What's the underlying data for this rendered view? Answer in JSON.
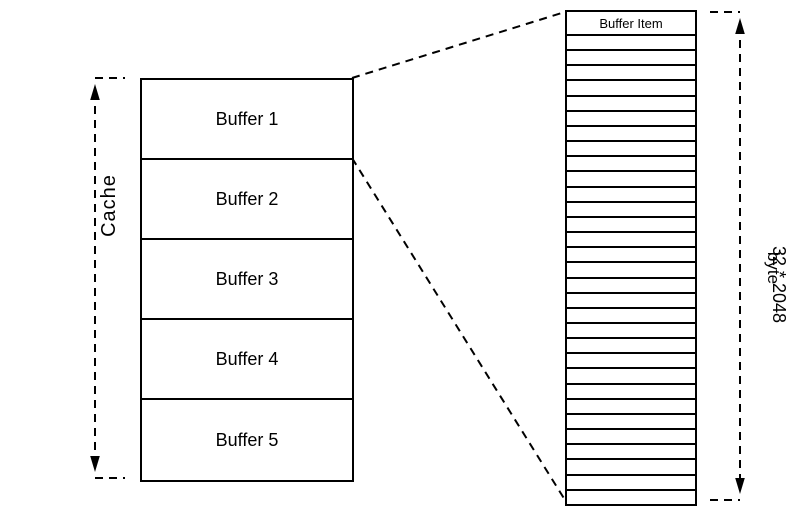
{
  "left_label": "Cache",
  "cache_cells": [
    "Buffer 1",
    "Buffer 2",
    "Buffer 3",
    "Buffer 4",
    "Buffer 5"
  ],
  "detail_header": "Buffer Item",
  "detail_row_count": 31,
  "right_line1": "32 * 2048",
  "right_line2": "byte",
  "chart_data": {
    "type": "diagram",
    "cache": {
      "name": "Cache",
      "buffers": [
        "Buffer 1",
        "Buffer 2",
        "Buffer 3",
        "Buffer 4",
        "Buffer 5"
      ]
    },
    "buffer_expansion": {
      "items_per_buffer": 32,
      "bytes_per_item": 2048,
      "item_label": "Buffer Item",
      "size_expression": "32 * 2048 byte"
    }
  }
}
